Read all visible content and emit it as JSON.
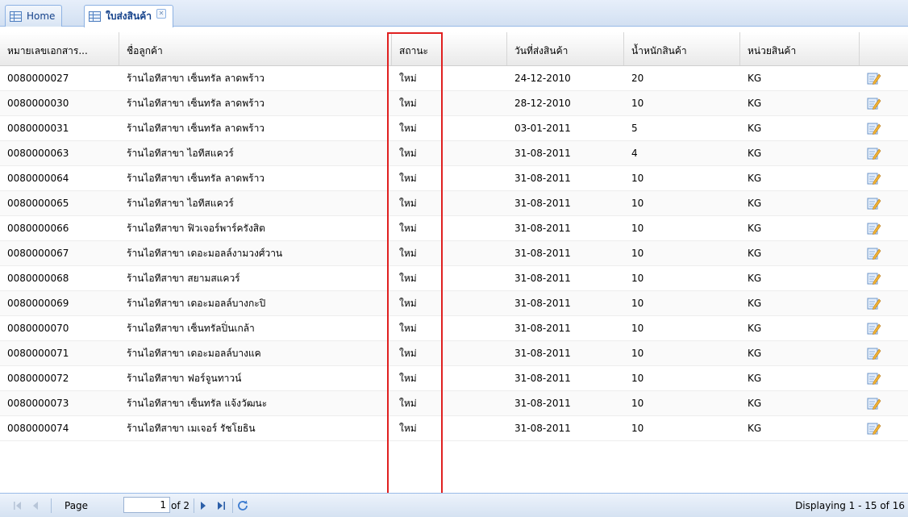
{
  "tabs": [
    {
      "label": "Home",
      "active": false
    },
    {
      "label": "ใบส่งสินค้า",
      "active": true
    }
  ],
  "columns": {
    "doc_no": "หมายเลขเอกสาร...",
    "customer": "ชื่อลูกค้า",
    "status": "สถานะ",
    "ship_date": "วันที่ส่งสินค้า",
    "weight": "น้ำหนักสินค้า",
    "unit": "หน่วยสินค้า"
  },
  "rows": [
    {
      "doc_no": "0080000027",
      "customer": "ร้านไอทีสาขา เซ็นทรัล ลาดพร้าว",
      "status": "ใหม่",
      "ship_date": "24-12-2010",
      "weight": "20",
      "unit": "KG"
    },
    {
      "doc_no": "0080000030",
      "customer": "ร้านไอทีสาขา เซ็นทรัล ลาดพร้าว",
      "status": "ใหม่",
      "ship_date": "28-12-2010",
      "weight": "10",
      "unit": "KG"
    },
    {
      "doc_no": "0080000031",
      "customer": "ร้านไอทีสาขา เซ็นทรัล ลาดพร้าว",
      "status": "ใหม่",
      "ship_date": "03-01-2011",
      "weight": "5",
      "unit": "KG"
    },
    {
      "doc_no": "0080000063",
      "customer": "ร้านไอทีสาขา ไอทีสแควร์",
      "status": "ใหม่",
      "ship_date": "31-08-2011",
      "weight": "4",
      "unit": "KG"
    },
    {
      "doc_no": "0080000064",
      "customer": "ร้านไอทีสาขา เซ็นทรัล ลาดพร้าว",
      "status": "ใหม่",
      "ship_date": "31-08-2011",
      "weight": "10",
      "unit": "KG"
    },
    {
      "doc_no": "0080000065",
      "customer": "ร้านไอทีสาขา ไอทีสแควร์",
      "status": "ใหม่",
      "ship_date": "31-08-2011",
      "weight": "10",
      "unit": "KG"
    },
    {
      "doc_no": "0080000066",
      "customer": "ร้านไอทีสาขา ฟิวเจอร์พาร์ครังสิต",
      "status": "ใหม่",
      "ship_date": "31-08-2011",
      "weight": "10",
      "unit": "KG"
    },
    {
      "doc_no": "0080000067",
      "customer": "ร้านไอทีสาขา เดอะมอลล์งามวงศ์วาน",
      "status": "ใหม่",
      "ship_date": "31-08-2011",
      "weight": "10",
      "unit": "KG"
    },
    {
      "doc_no": "0080000068",
      "customer": "ร้านไอทีสาขา สยามสแควร์",
      "status": "ใหม่",
      "ship_date": "31-08-2011",
      "weight": "10",
      "unit": "KG"
    },
    {
      "doc_no": "0080000069",
      "customer": "ร้านไอทีสาขา เดอะมอลล์บางกะปิ",
      "status": "ใหม่",
      "ship_date": "31-08-2011",
      "weight": "10",
      "unit": "KG"
    },
    {
      "doc_no": "0080000070",
      "customer": "ร้านไอทีสาขา เซ็นทรัลปิ่นเกล้า",
      "status": "ใหม่",
      "ship_date": "31-08-2011",
      "weight": "10",
      "unit": "KG"
    },
    {
      "doc_no": "0080000071",
      "customer": "ร้านไอทีสาขา เดอะมอลล์บางแค",
      "status": "ใหม่",
      "ship_date": "31-08-2011",
      "weight": "10",
      "unit": "KG"
    },
    {
      "doc_no": "0080000072",
      "customer": "ร้านไอทีสาขา ฟอร์จูนทาวน์",
      "status": "ใหม่",
      "ship_date": "31-08-2011",
      "weight": "10",
      "unit": "KG"
    },
    {
      "doc_no": "0080000073",
      "customer": "ร้านไอทีสาขา เซ็นทรัล แจ้งวัฒนะ",
      "status": "ใหม่",
      "ship_date": "31-08-2011",
      "weight": "10",
      "unit": "KG"
    },
    {
      "doc_no": "0080000074",
      "customer": "ร้านไอทีสาขา เมเจอร์ รัชโยธิน",
      "status": "ใหม่",
      "ship_date": "31-08-2011",
      "weight": "10",
      "unit": "KG"
    }
  ],
  "pager": {
    "page_label": "Page",
    "current_page": "1",
    "of_label": "of 2",
    "display_text": "Displaying 1 - 15 of 16"
  },
  "colors": {
    "accent": "#15428b",
    "highlight": "#e02020",
    "header_border": "#99bbe8"
  }
}
